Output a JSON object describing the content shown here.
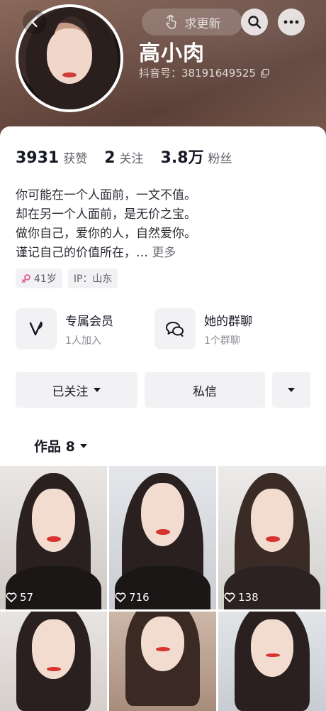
{
  "header": {
    "nickname": "高小肉",
    "douyin_id": "抖音号：38191649525",
    "update_button": "求更新"
  },
  "stats": [
    {
      "num": "3931",
      "label": "获赞"
    },
    {
      "num": "2",
      "label": "关注"
    },
    {
      "num": "3.8万",
      "label": "粉丝"
    }
  ],
  "bio": {
    "lines": [
      "你可能在一个人面前，一文不值。",
      "却在另一个人面前，是无价之宝。",
      "做你自己，爱你的人，自然爱你。",
      "谨记自己的价值所在，… "
    ],
    "more": "更多"
  },
  "tags": {
    "age": "41岁",
    "ip": "IP：山东"
  },
  "features": [
    {
      "title": "专属会员",
      "sub": "1人加入",
      "icon": "vip-v-icon"
    },
    {
      "title": "她的群聊",
      "sub": "1个群聊",
      "icon": "group-chat-icon"
    }
  ],
  "actions": {
    "followed": "已关注",
    "message": "私信"
  },
  "tab": {
    "label": "作品 8"
  },
  "works": [
    {
      "likes": "57"
    },
    {
      "likes": "716"
    },
    {
      "likes": "138"
    },
    {
      "likes": ""
    },
    {
      "likes": ""
    },
    {
      "likes": ""
    }
  ],
  "colors": {
    "header_bg": "#6e4f45",
    "female_icon": "#e05a8a",
    "text_primary": "#161823",
    "text_secondary": "#5f6068",
    "button_bg": "#f2f2f4"
  }
}
